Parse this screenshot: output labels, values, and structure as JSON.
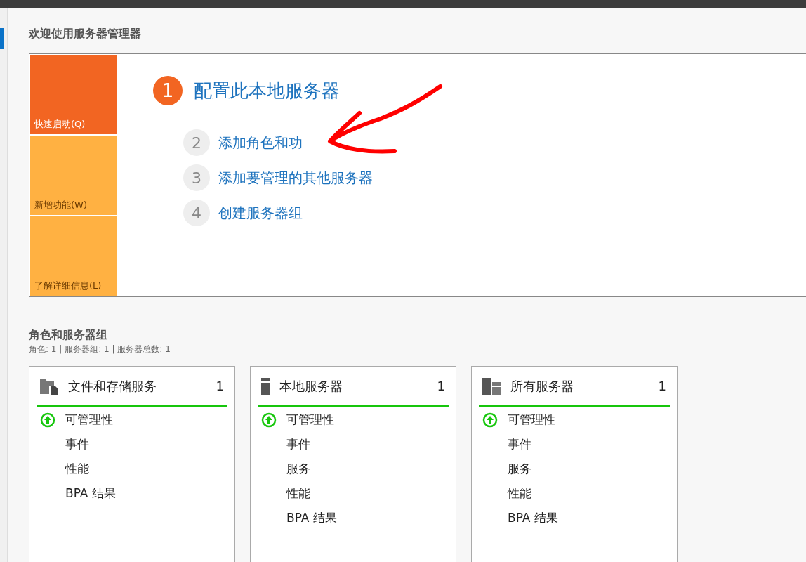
{
  "welcome": {
    "title": "欢迎使用服务器管理器",
    "tiles": [
      {
        "label": "快速启动(Q)",
        "selected": true
      },
      {
        "label": "新增功能(W)",
        "selected": false
      },
      {
        "label": "了解详细信息(L)",
        "selected": false
      }
    ],
    "steps": [
      {
        "number": "1",
        "label": "配置此本地服务器",
        "selected": true
      },
      {
        "number": "2",
        "label": "添加角色和功",
        "selected": false
      },
      {
        "number": "3",
        "label": "添加要管理的其他服务器",
        "selected": false
      },
      {
        "number": "4",
        "label": "创建服务器组",
        "selected": false
      }
    ]
  },
  "roles": {
    "title": "角色和服务器组",
    "summary": "角色: 1 | 服务器组: 1 | 服务器总数: 1",
    "cards": [
      {
        "kind": "files",
        "title": "文件和存储服务",
        "count": "1",
        "items": [
          {
            "label": "可管理性",
            "ok": true
          },
          {
            "label": "事件",
            "ok": false
          },
          {
            "label": "性能",
            "ok": false
          },
          {
            "label": "BPA 结果",
            "ok": false
          }
        ]
      },
      {
        "kind": "server",
        "title": "本地服务器",
        "count": "1",
        "items": [
          {
            "label": "可管理性",
            "ok": true
          },
          {
            "label": "事件",
            "ok": false
          },
          {
            "label": "服务",
            "ok": false
          },
          {
            "label": "性能",
            "ok": false
          },
          {
            "label": "BPA 结果",
            "ok": false
          }
        ]
      },
      {
        "kind": "servers",
        "title": "所有服务器",
        "count": "1",
        "items": [
          {
            "label": "可管理性",
            "ok": true
          },
          {
            "label": "事件",
            "ok": false
          },
          {
            "label": "服务",
            "ok": false
          },
          {
            "label": "性能",
            "ok": false
          },
          {
            "label": "BPA 结果",
            "ok": false
          }
        ]
      }
    ]
  }
}
